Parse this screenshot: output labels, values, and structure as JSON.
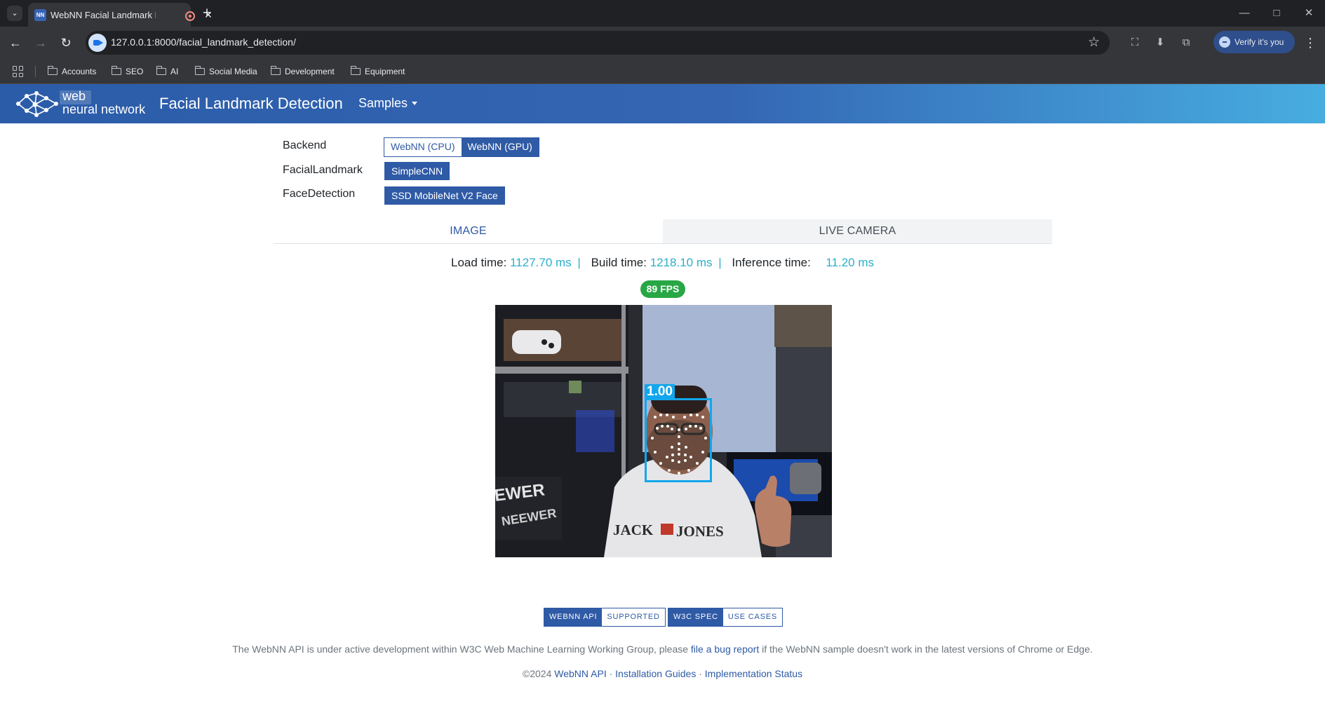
{
  "browser": {
    "tab_title": "WebNN Facial Landmark Detection",
    "url": "127.0.0.1:8000/facial_landmark_detection/",
    "verify_label": "Verify it's you",
    "bookmarks": [
      "Accounts",
      "SEO",
      "AI",
      "Social Media",
      "Development",
      "Equipment"
    ]
  },
  "navbar": {
    "logo_line1": "web",
    "logo_line2": "neural network",
    "title": "Facial Landmark Detection",
    "samples_label": "Samples"
  },
  "options": {
    "backend_label": "Backend",
    "backend_options": [
      "WebNN (CPU)",
      "WebNN (GPU)"
    ],
    "backend_selected": "WebNN (GPU)",
    "landmark_label": "FacialLandmark",
    "landmark_option": "SimpleCNN",
    "detection_label": "FaceDetection",
    "detection_option": "SSD MobileNet V2 Face"
  },
  "tabs": {
    "image": "IMAGE",
    "live_camera": "LIVE CAMERA",
    "active": "IMAGE"
  },
  "timings": {
    "load_label": "Load time:",
    "load_value": "1127.70 ms",
    "build_label": "Build time:",
    "build_value": "1218.10 ms",
    "inference_label": "Inference time:",
    "inference_value": "11.20 ms",
    "separator": "|"
  },
  "fps": "89 FPS",
  "detection": {
    "score": "1.00"
  },
  "scene_text": {
    "hoodie_left": "JACK",
    "hoodie_right": "JONES",
    "light_1": "EWER",
    "light_2": "NEEWER"
  },
  "footer": {
    "shield_webnn_api": "WEBNN API",
    "shield_supported": "SUPPORTED",
    "shield_w3c_spec": "W3C SPEC",
    "shield_use_cases": "USE CASES",
    "note_before": "The WebNN API is under active development within W3C Web Machine Learning Working Group, please",
    "note_link": "file a bug report",
    "note_after": "if the WebNN sample doesn't work in the latest versions of Chrome or Edge.",
    "copyright": "©2024",
    "link_api": "WebNN API",
    "link_install": "Installation Guides",
    "link_status": "Implementation Status",
    "dot": "·"
  },
  "colors": {
    "primary": "#2f5aa5",
    "timing_value": "#2ab0c9",
    "fps_badge": "#28a745",
    "detection_box": "#12a7ec"
  }
}
